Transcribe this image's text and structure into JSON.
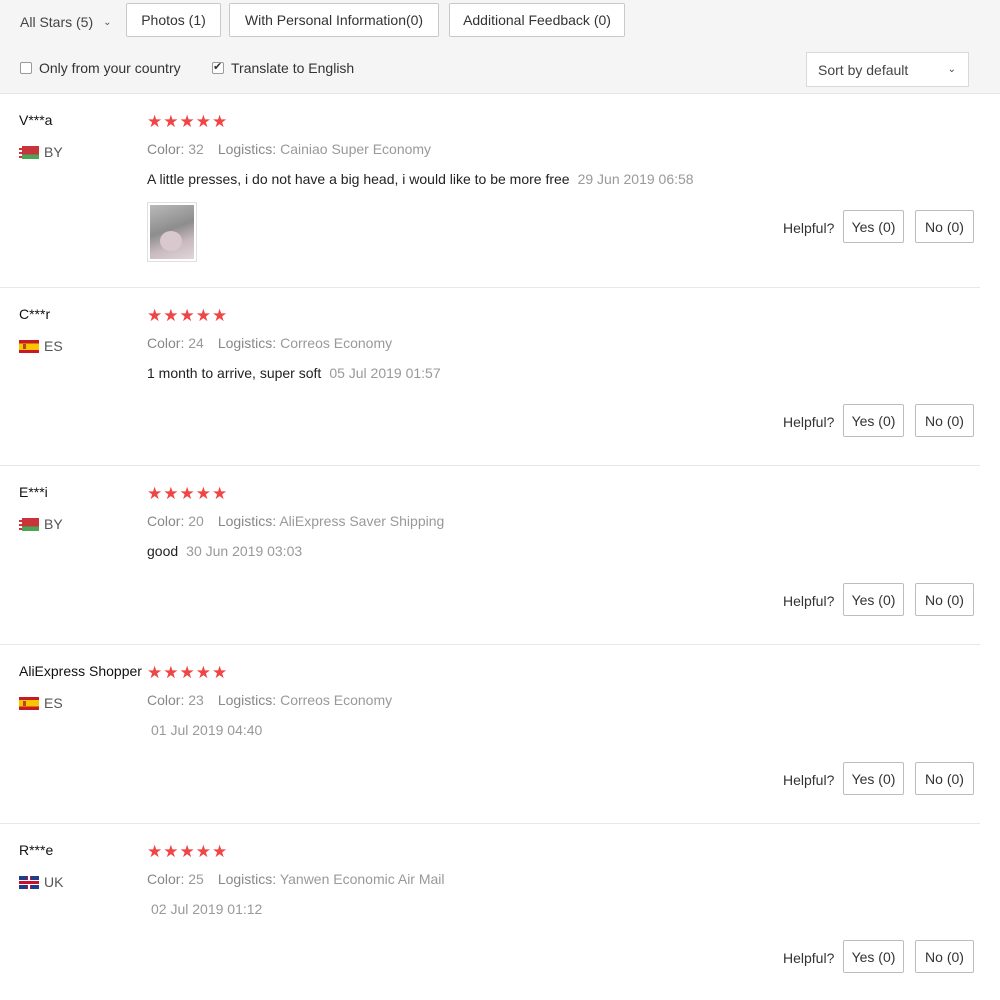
{
  "filters": {
    "all_stars": "All Stars (5)",
    "photos": "Photos (1)",
    "personal": "With Personal Information(0)",
    "additional": "Additional Feedback (0)",
    "only_country": "Only from your country",
    "translate": "Translate to English",
    "translate_checked": true,
    "only_country_checked": false,
    "sort": "Sort by default"
  },
  "labels": {
    "color": "Color:",
    "logistics": "Logistics:",
    "helpful": "Helpful?",
    "stars": "★★★★★"
  },
  "reviews": [
    {
      "user": "V***a",
      "country": "BY",
      "flag": "belarus-flag-icon",
      "rating": 5,
      "color": "32",
      "logistics": "Cainiao Super Economy",
      "text": "A little presses, i do not have a big head, i would like to be more free",
      "date": "29 Jun 2019 06:58",
      "has_photo": true,
      "yes": "Yes (0)",
      "no": "No (0)"
    },
    {
      "user": "C***r",
      "country": "ES",
      "flag": "spain-flag-icon",
      "rating": 5,
      "color": "24",
      "logistics": "Correos Economy",
      "text": "1 month to arrive, super soft",
      "date": "05 Jul 2019 01:57",
      "has_photo": false,
      "yes": "Yes (0)",
      "no": "No (0)"
    },
    {
      "user": "E***i",
      "country": "BY",
      "flag": "belarus-flag-icon",
      "rating": 5,
      "color": "20",
      "logistics": "AliExpress Saver Shipping",
      "text": "good",
      "date": "30 Jun 2019 03:03",
      "has_photo": false,
      "yes": "Yes (0)",
      "no": "No (0)"
    },
    {
      "user": "AliExpress Shopper",
      "country": "ES",
      "flag": "spain-flag-icon",
      "rating": 5,
      "color": "23",
      "logistics": "Correos Economy",
      "text": "",
      "date": "01 Jul 2019 04:40",
      "has_photo": false,
      "yes": "Yes (0)",
      "no": "No (0)"
    },
    {
      "user": "R***e",
      "country": "UK",
      "flag": "uk-flag-icon",
      "rating": 5,
      "color": "25",
      "logistics": "Yanwen Economic Air Mail",
      "text": "",
      "date": "02 Jul 2019 01:12",
      "has_photo": false,
      "yes": "Yes (0)",
      "no": "No (0)"
    }
  ]
}
